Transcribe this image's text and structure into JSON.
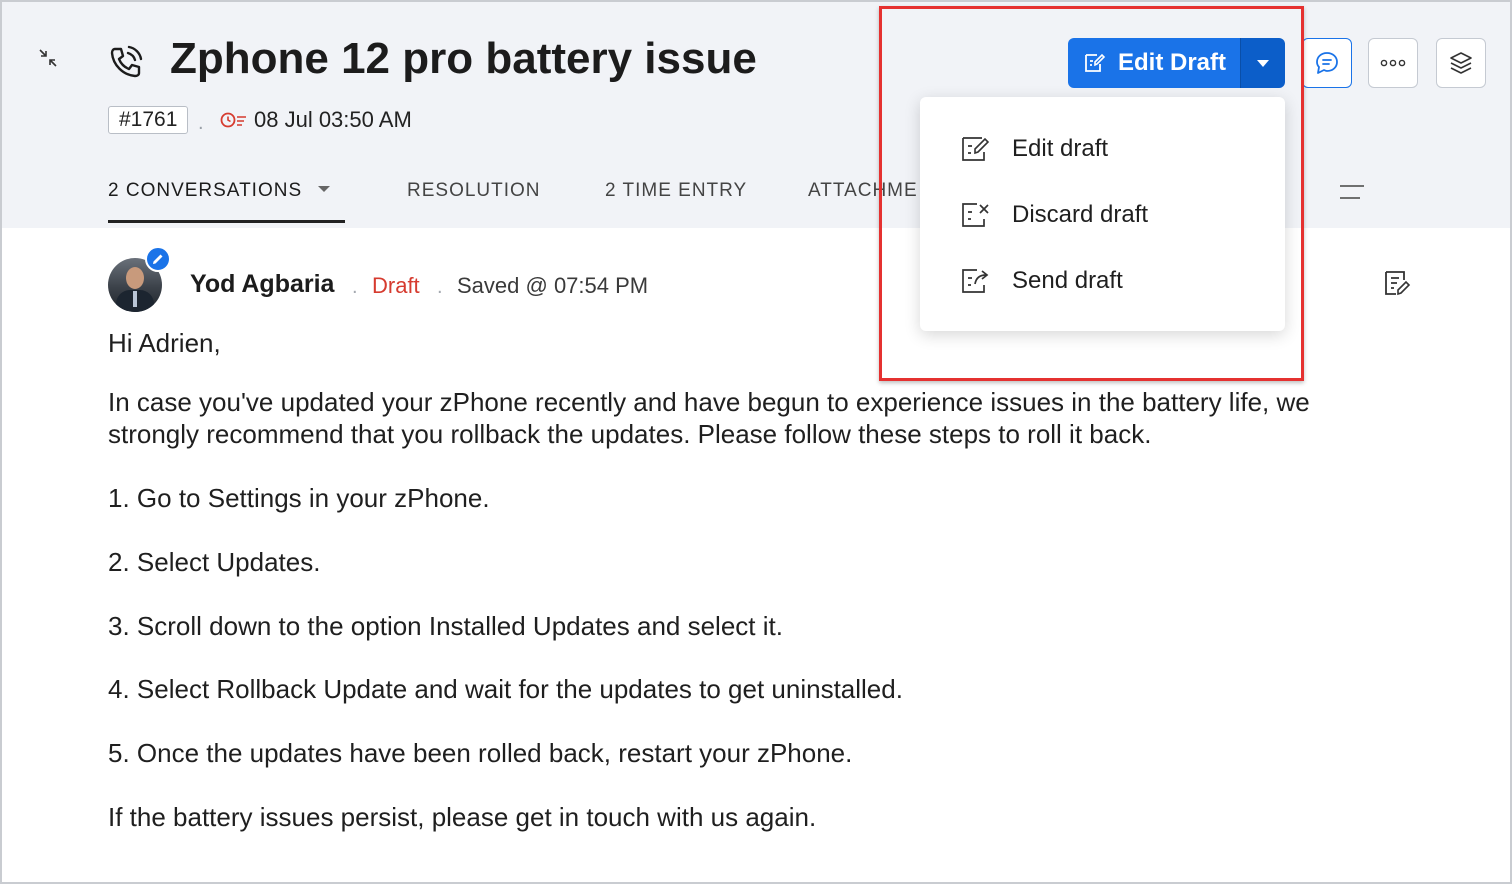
{
  "ticket": {
    "title": "Zphone 12 pro battery issue",
    "id": "#1761",
    "due_date": "08 Jul 03:50 AM"
  },
  "tabs": [
    {
      "label": "2 CONVERSATIONS"
    },
    {
      "label": "RESOLUTION"
    },
    {
      "label": "2 TIME ENTRY"
    },
    {
      "label": "ATTACHME"
    }
  ],
  "toolbar": {
    "edit_draft_label": "Edit Draft"
  },
  "dropdown": {
    "items": [
      {
        "label": "Edit draft",
        "icon": "edit-draft-icon"
      },
      {
        "label": "Discard draft",
        "icon": "discard-draft-icon"
      },
      {
        "label": "Send draft",
        "icon": "send-draft-icon"
      }
    ]
  },
  "message": {
    "sender": "Yod Agbaria",
    "status": "Draft",
    "saved": "Saved @ 07:54 PM",
    "greeting": "Hi Adrien,",
    "intro_line1": "In case you've updated your zPhone recently and have begun to experience issues in the battery life, we",
    "intro_line2": "strongly recommend that you rollback the updates. Please follow these steps to roll it back.",
    "steps": [
      "1. Go to Settings in your zPhone.",
      "2. Select Updates.",
      "3. Scroll down to the option Installed Updates and select it.",
      "4. Select Rollback Update and wait for the updates to get uninstalled.",
      "5. Once the updates have been rolled back, restart your zPhone."
    ],
    "closing": "If the battery issues persist, please get in touch with us again."
  },
  "colors": {
    "accent": "#1a73e8",
    "draft": "#d63b2f",
    "highlight": "#e53130"
  }
}
